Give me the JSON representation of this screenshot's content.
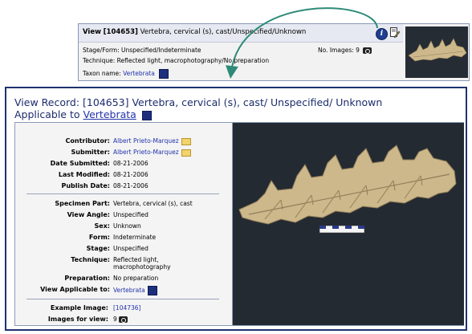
{
  "strip": {
    "view_label": "View",
    "record_id": "[104653]",
    "record_desc": "Vertebra, cervical (s), cast/Unspecified/Unknown",
    "stage_form": "Stage/Form: Unspecified/Indeterminate",
    "technique": "Technique: Reflected light, macrophotography/No preparation",
    "taxon_label": "Taxon name:",
    "taxon_value": "Vertebrata",
    "no_images": "No. Images: 9"
  },
  "record": {
    "title": "View Record: [104653] Vertebra, cervical (s), cast/ Unspecified/ Unknown",
    "applicable_prefix": "Applicable to",
    "applicable_link": "Vertebrata"
  },
  "details": {
    "contributor_label": "Contributor:",
    "contributor": "Albert Prieto-Marquez",
    "submitter_label": "Submitter:",
    "submitter": "Albert Prieto-Marquez",
    "date_submitted_label": "Date Submitted:",
    "date_submitted": "08-21-2006",
    "last_modified_label": "Last Modified:",
    "last_modified": "08-21-2006",
    "publish_date_label": "Publish Date:",
    "publish_date": "08-21-2006",
    "specimen_part_label": "Specimen Part:",
    "specimen_part": "Vertebra, cervical (s), cast",
    "view_angle_label": "View Angle:",
    "view_angle": "Unspecified",
    "sex_label": "Sex:",
    "sex": "Unknown",
    "form_label": "Form:",
    "form": "Indeterminate",
    "stage_label": "Stage:",
    "stage": "Unspecified",
    "technique_label": "Technique:",
    "technique": "Reflected light, macrophotography",
    "preparation_label": "Preparation:",
    "preparation": "No preparation",
    "view_applicable_label": "View Applicable to:",
    "view_applicable": "Vertebrata",
    "example_image_label": "Example Image:",
    "example_image": "[104736]",
    "images_for_view_label": "Images for view:",
    "images_for_view": "9"
  },
  "colors": {
    "frame": "#1f3270",
    "arrow": "#2e8b78",
    "link": "#2233aa",
    "photo_bg": "#1f252c",
    "bone": "#cdb88c"
  },
  "icons": [
    "info-icon",
    "edit-icon",
    "envelope-icon",
    "taxon-icon",
    "camera-icon"
  ]
}
